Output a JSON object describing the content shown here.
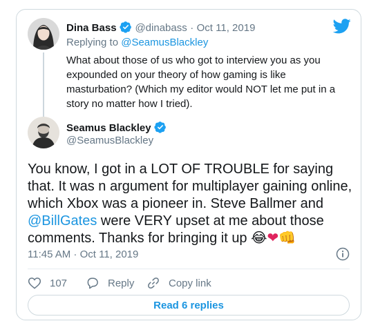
{
  "reply_tweet": {
    "author_name": "Dina Bass",
    "handle": "@dinabass",
    "date_sep": "·",
    "date": "Oct 11, 2019",
    "replying_prefix": "Replying to",
    "replying_to": "@SeamusBlackley",
    "text": "What about those of us who got to interview you as you expounded on your theory of how gaming is like masturbation? (Which my editor would NOT let me put in a story no matter how I tried)."
  },
  "main_tweet": {
    "author_name": "Seamus Blackley",
    "handle": "@SeamusBlackley",
    "text_before_mention": "You know, I got in a LOT OF TROUBLE for saying that. It was n argument for multiplayer gaining online, which Xbox was a pioneer in. Steve Ballmer and ",
    "mention": "@BillGates",
    "text_after_mention": " were VERY upset at me about those comments. Thanks for bringing it up ",
    "emoji": [
      "😂",
      "❤",
      "👊"
    ],
    "timestamp": "11:45 AM · Oct 11, 2019"
  },
  "actions": {
    "like_count": "107",
    "reply_label": "Reply",
    "copy_link_label": "Copy link",
    "read_replies_label": "Read 6 replies"
  },
  "icons": {
    "brand": "twitter-bird-icon",
    "verified_color": "#1da1f2",
    "accent": "#1b95e0"
  }
}
